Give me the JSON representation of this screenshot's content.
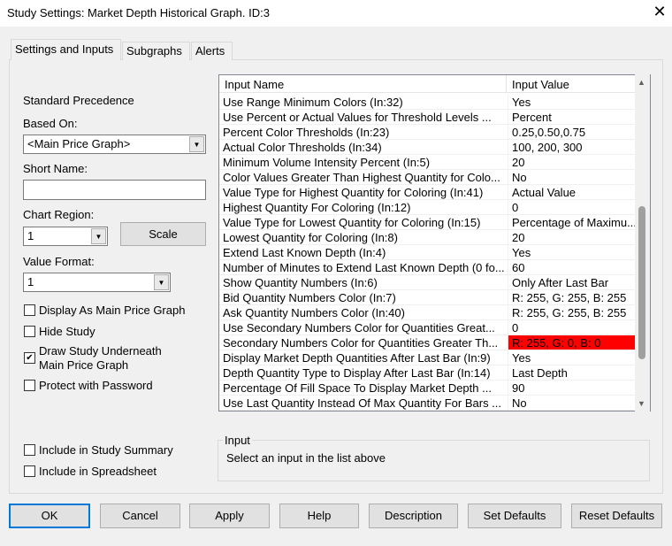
{
  "window": {
    "title": "Study Settings: Market Depth Historical Graph. ID:3",
    "close": "✕"
  },
  "tabs": [
    "Settings and Inputs",
    "Subgraphs",
    "Alerts"
  ],
  "left": {
    "standard_precedence": "Standard Precedence",
    "based_on_label": "Based On:",
    "based_on_value": "<Main Price Graph>",
    "short_name_label": "Short Name:",
    "short_name_value": "",
    "chart_region_label": "Chart Region:",
    "chart_region_value": "1",
    "scale_button": "Scale",
    "value_format_label": "Value Format:",
    "value_format_value": "1",
    "checkboxes": [
      {
        "label": "Display As Main Price Graph",
        "checked": false
      },
      {
        "label": "Hide Study",
        "checked": false
      },
      {
        "label": "Draw Study Underneath\nMain Price Graph",
        "checked": true
      },
      {
        "label": "Protect with Password",
        "checked": false
      },
      {
        "label": "Include in Study Summary",
        "checked": false
      },
      {
        "label": "Include in Spreadsheet",
        "checked": false
      }
    ]
  },
  "inputs": {
    "headers": [
      "Input Name",
      "Input Value"
    ],
    "rows": [
      {
        "name": "Use Range Minimum Colors   (In:32)",
        "value": "Yes"
      },
      {
        "name": "Use Percent or Actual Values for Threshold Levels   ...",
        "value": "Percent"
      },
      {
        "name": "Percent Color Thresholds   (In:23)",
        "value": "0.25,0.50,0.75"
      },
      {
        "name": "Actual Color Thresholds   (In:34)",
        "value": "100, 200, 300"
      },
      {
        "name": "Minimum Volume Intensity Percent   (In:5)",
        "value": "20"
      },
      {
        "name": "Color Values Greater Than Highest Quantity for Colo...",
        "value": "No"
      },
      {
        "name": "Value Type for Highest Quantity for Coloring   (In:41)",
        "value": "Actual Value"
      },
      {
        "name": "Highest Quantity For Coloring   (In:12)",
        "value": "0"
      },
      {
        "name": "Value Type for Lowest Quantity for Coloring   (In:15)",
        "value": "Percentage of Maximu..."
      },
      {
        "name": "Lowest Quantity for Coloring   (In:8)",
        "value": "20"
      },
      {
        "name": "Extend Last Known Depth   (In:4)",
        "value": "Yes"
      },
      {
        "name": "Number of Minutes to Extend Last Known Depth (0 fo...",
        "value": "60"
      },
      {
        "name": "Show Quantity Numbers   (In:6)",
        "value": "Only After Last Bar"
      },
      {
        "name": "Bid Quantity Numbers Color   (In:7)",
        "value": "R: 255, G: 255, B: 255"
      },
      {
        "name": "Ask Quantity Numbers Color   (In:40)",
        "value": "R: 255, G: 255, B: 255"
      },
      {
        "name": "Use Secondary Numbers Color for Quantities Great...",
        "value": "0"
      },
      {
        "name": "Secondary Numbers Color for Quantities Greater Th...",
        "value": "R: 255, G: 0, B: 0",
        "swatch": "#ff0000"
      },
      {
        "name": "Display Market Depth Quantities After Last Bar   (In:9)",
        "value": "Yes"
      },
      {
        "name": "Depth Quantity Type to Display After Last Bar   (In:14)",
        "value": "Last Depth"
      },
      {
        "name": "Percentage Of Fill Space To Display Market Depth ...",
        "value": "90"
      },
      {
        "name": "Use Last Quantity Instead Of Max Quantity For Bars   ...",
        "value": "No"
      }
    ]
  },
  "input_group": {
    "title": "Input",
    "text": "Select an input in the list above"
  },
  "buttons": [
    "OK",
    "Cancel",
    "Apply",
    "Help",
    "Description",
    "Set Defaults",
    "Reset Defaults"
  ]
}
